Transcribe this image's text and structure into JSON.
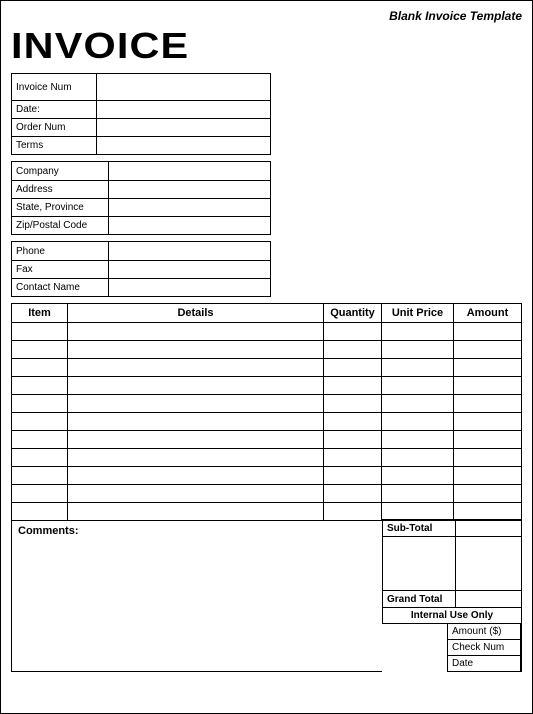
{
  "top_label": "Blank Invoice Template",
  "title": "INVOICE",
  "meta_block": [
    {
      "label": "Invoice Num",
      "value": ""
    },
    {
      "label": "Date:",
      "value": ""
    },
    {
      "label": "Order Num",
      "value": ""
    },
    {
      "label": "Terms",
      "value": ""
    }
  ],
  "addr_block": [
    {
      "label": "Company",
      "value": ""
    },
    {
      "label": "Address",
      "value": ""
    },
    {
      "label": "State, Province",
      "value": ""
    },
    {
      "label": "Zip/Postal Code",
      "value": ""
    }
  ],
  "contact_block": [
    {
      "label": "Phone",
      "value": ""
    },
    {
      "label": "Fax",
      "value": ""
    },
    {
      "label": "Contact Name",
      "value": ""
    }
  ],
  "columns": {
    "item": "Item",
    "details": "Details",
    "qty": "Quantity",
    "price": "Unit Price",
    "amount": "Amount"
  },
  "rows": [
    {
      "item": "",
      "details": "",
      "qty": "",
      "price": "",
      "amount": ""
    },
    {
      "item": "",
      "details": "",
      "qty": "",
      "price": "",
      "amount": ""
    },
    {
      "item": "",
      "details": "",
      "qty": "",
      "price": "",
      "amount": ""
    },
    {
      "item": "",
      "details": "",
      "qty": "",
      "price": "",
      "amount": ""
    },
    {
      "item": "",
      "details": "",
      "qty": "",
      "price": "",
      "amount": ""
    },
    {
      "item": "",
      "details": "",
      "qty": "",
      "price": "",
      "amount": ""
    },
    {
      "item": "",
      "details": "",
      "qty": "",
      "price": "",
      "amount": ""
    },
    {
      "item": "",
      "details": "",
      "qty": "",
      "price": "",
      "amount": ""
    },
    {
      "item": "",
      "details": "",
      "qty": "",
      "price": "",
      "amount": ""
    },
    {
      "item": "",
      "details": "",
      "qty": "",
      "price": "",
      "amount": ""
    },
    {
      "item": "",
      "details": "",
      "qty": "",
      "price": "",
      "amount": ""
    }
  ],
  "comments_label": "Comments:",
  "totals": {
    "subtotal_label": "Sub-Total",
    "subtotal": "",
    "grand_label": "Grand Total",
    "grand": ""
  },
  "internal": {
    "header": "Internal Use Only",
    "amount_label": "Amount ($)",
    "amount": "",
    "check_label": "Check Num",
    "check": "",
    "date_label": "Date",
    "date": ""
  }
}
